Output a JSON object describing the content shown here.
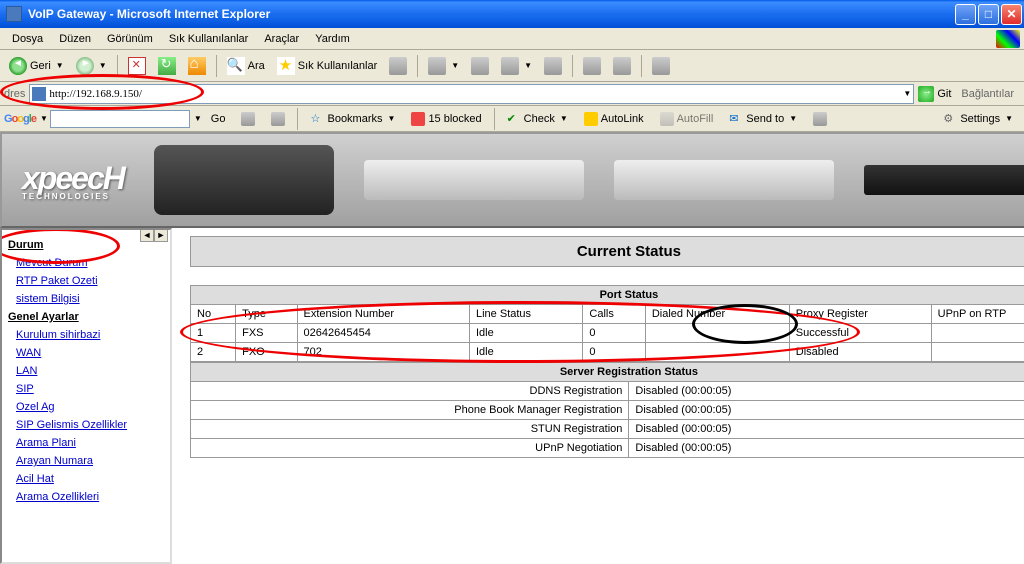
{
  "window": {
    "title": "VoIP Gateway - Microsoft Internet Explorer"
  },
  "menu": {
    "file": "Dosya",
    "edit": "Düzen",
    "view": "Görünüm",
    "favorites": "Sık Kullanılanlar",
    "tools": "Araçlar",
    "help": "Yardım"
  },
  "toolbar": {
    "back": "Geri",
    "search": "Ara",
    "favorites": "Sık Kullanılanlar"
  },
  "address": {
    "label": "dres",
    "url": "http://192.168.9.150/",
    "go": "Git",
    "links": "Bağlantılar"
  },
  "google": {
    "go": "Go",
    "bookmarks": "Bookmarks",
    "blocked": "15 blocked",
    "check": "Check",
    "autolink": "AutoLink",
    "autofill": "AutoFill",
    "sendto": "Send to",
    "settings": "Settings"
  },
  "brand": {
    "name": "xpeecH",
    "sub": "TECHNOLOGIES"
  },
  "sidebar": {
    "section1": "Durum",
    "items1": [
      "Mevcut Durum",
      "RTP Paket Ozeti",
      "sistem Bilgisi"
    ],
    "section2": "Genel Ayarlar",
    "items2": [
      "Kurulum sihirbazi",
      "WAN",
      "LAN",
      "SIP",
      "Ozel Ag",
      "SIP Gelismis Ozellikler",
      "Arama Plani",
      "Arayan Numara",
      "Acil Hat",
      "Arama Ozellikleri"
    ]
  },
  "page": {
    "title": "Current Status",
    "port_section": "Port Status",
    "headers": [
      "No",
      "Type",
      "Extension Number",
      "Line Status",
      "Calls",
      "Dialed Number",
      "Proxy Register",
      "UPnP on RTP"
    ],
    "rows": [
      {
        "no": "1",
        "type": "FXS",
        "ext": "02642645454",
        "line": "Idle",
        "calls": "0",
        "dialed": "",
        "proxy": "Successful",
        "upnp": ""
      },
      {
        "no": "2",
        "type": "FXO",
        "ext": "702",
        "line": "Idle",
        "calls": "0",
        "dialed": "",
        "proxy": "Disabled",
        "upnp": ""
      }
    ],
    "reg_section": "Server Registration Status",
    "reg": [
      {
        "label": "DDNS Registration",
        "value": "Disabled (00:00:05)"
      },
      {
        "label": "Phone Book Manager Registration",
        "value": "Disabled (00:00:05)"
      },
      {
        "label": "STUN Registration",
        "value": "Disabled (00:00:05)"
      },
      {
        "label": "UPnP Negotiation",
        "value": "Disabled (00:00:05)"
      }
    ]
  }
}
